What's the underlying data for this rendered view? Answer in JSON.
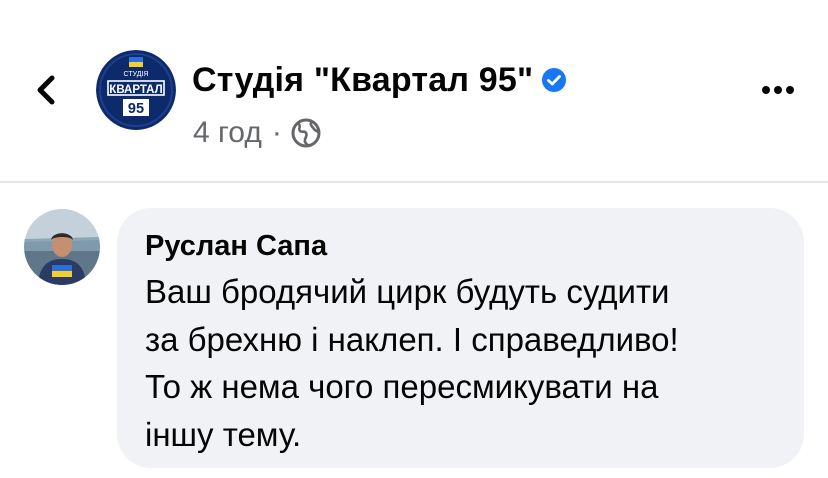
{
  "header": {
    "page_name": "Студія \"Квартал 95\"",
    "post_time": "4 год",
    "meta_separator": "·",
    "back_icon": "chevron-left-icon",
    "more_icon": "more-horizontal-icon",
    "verified_icon": "verified-badge-icon",
    "audience_icon": "globe-icon",
    "logo": {
      "top_text": "СТУДІЯ",
      "middle_text": "КВАРТАЛ",
      "bottom_text": "95"
    }
  },
  "comment": {
    "author": "Руслан Сапа",
    "lines": [
      "Ваш бродячий цирк будуть судити",
      "за брехню і наклеп. І справедливо!",
      "То ж нема чого пересмикувати на",
      "іншу тему."
    ]
  },
  "colors": {
    "verified": "#1877f2",
    "bubble": "#f0f2f5",
    "secondary_text": "#65676b",
    "logo_background": "#0d2a6b"
  }
}
